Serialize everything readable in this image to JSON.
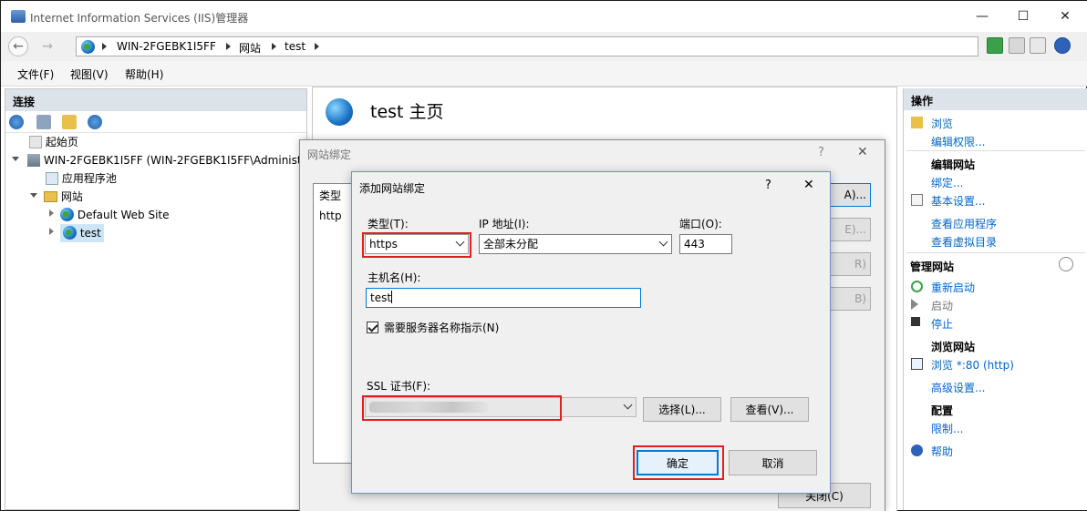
{
  "window": {
    "title": "Internet Information Services (IIS)管理器",
    "minimize": "—",
    "maximize": "☐",
    "close": "✕"
  },
  "address": {
    "back": "←",
    "forward": "→",
    "crumbs": [
      "WIN-2FGEBK1I5FF",
      "网站",
      "test"
    ]
  },
  "menu": [
    "文件(F)",
    "视图(V)",
    "帮助(H)"
  ],
  "connections": {
    "header": "连接",
    "tree": [
      {
        "label": "起始页"
      },
      {
        "label": "WIN-2FGEBK1I5FF (WIN-2FGEBK1I5FF\\Administr"
      },
      {
        "label": "应用程序池"
      },
      {
        "label": "网站"
      },
      {
        "label": "Default Web Site"
      },
      {
        "label": "test"
      }
    ]
  },
  "center": {
    "title": "test 主页"
  },
  "actions": {
    "header": "操作",
    "browse": "浏览",
    "edit_perms": "编辑权限...",
    "edit_site": "编辑网站",
    "bindings": "绑定...",
    "basic_settings": "基本设置...",
    "view_apps": "查看应用程序",
    "view_vdirs": "查看虚拟目录",
    "manage_site": "管理网站",
    "restart": "重新启动",
    "start": "启动",
    "stop": "停止",
    "browse_site": "浏览网站",
    "browse_80": "浏览 *:80 (http)",
    "advanced": "高级设置...",
    "config": "配置",
    "limits": "限制...",
    "help": "帮助"
  },
  "site_bindings": {
    "title": "网站绑定",
    "help": "?",
    "close_x": "✕",
    "col_type": "类型",
    "row_type": "http",
    "btn_add": "A)...",
    "btn_edit": "E)...",
    "btn_remove": "R)",
    "btn_browse": "B)",
    "btn_close": "关闭(C)"
  },
  "add_binding": {
    "title": "添加网站绑定",
    "help": "?",
    "close_x": "✕",
    "type_label": "类型(T):",
    "type_value": "https",
    "ip_label": "IP 地址(I):",
    "ip_value": "全部未分配",
    "port_label": "端口(O):",
    "port_value": "443",
    "host_label": "主机名(H):",
    "host_value": "test",
    "sni_label": "需要服务器名称指示(N)",
    "ssl_label": "SSL 证书(F):",
    "select_btn": "选择(L)...",
    "view_btn": "查看(V)...",
    "ok_btn": "确定",
    "cancel_btn": "取消"
  }
}
